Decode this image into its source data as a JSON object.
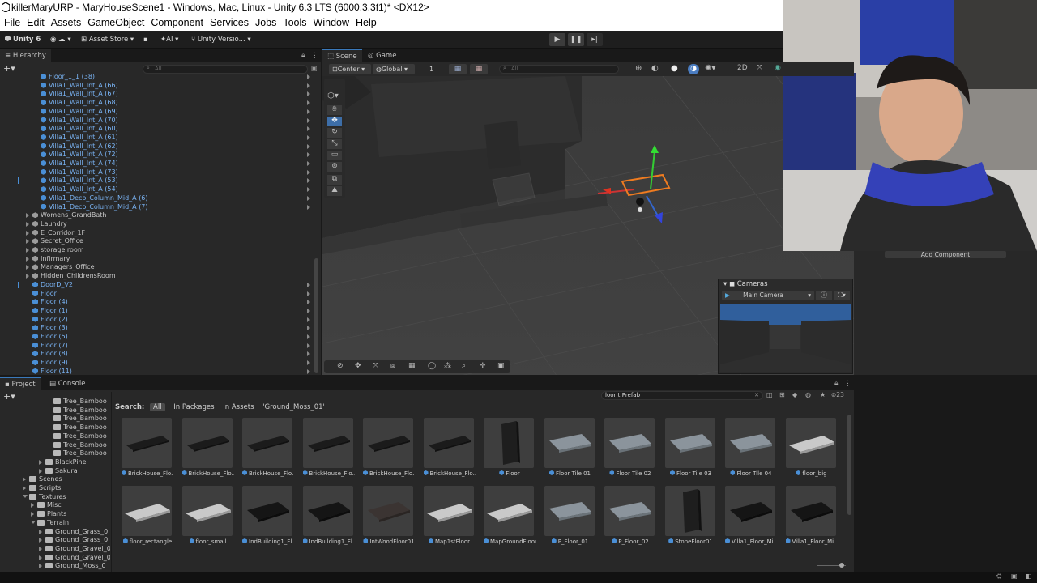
{
  "window": {
    "title": "killerMaryURP - MaryHouseScene1 - Windows, Mac, Linux - Unity 6.3 LTS (6000.3.3f1)* <DX12>"
  },
  "menu": [
    "File",
    "Edit",
    "Assets",
    "GameObject",
    "Component",
    "Services",
    "Jobs",
    "Tools",
    "Window",
    "Help"
  ],
  "toolbar": {
    "account": "Unity 6",
    "asset_store": "Asset Store",
    "ai": "AI",
    "version_control": "Unity Versio..."
  },
  "hierarchy": {
    "tab": "Hierarchy",
    "search_placeholder": "All",
    "rows": [
      {
        "label": "Floor_1_1 (38)",
        "prefab": true,
        "indent": 2
      },
      {
        "label": "Villa1_Wall_Int_A (66)",
        "prefab": true,
        "indent": 2
      },
      {
        "label": "Villa1_Wall_Int_A (67)",
        "prefab": true,
        "indent": 2
      },
      {
        "label": "Villa1_Wall_Int_A (68)",
        "prefab": true,
        "indent": 2
      },
      {
        "label": "Villa1_Wall_Int_A (69)",
        "prefab": true,
        "indent": 2
      },
      {
        "label": "Villa1_Wall_Int_A (70)",
        "prefab": true,
        "indent": 2
      },
      {
        "label": "Villa1_Wall_Int_A (60)",
        "prefab": true,
        "indent": 2
      },
      {
        "label": "Villa1_Wall_Int_A (61)",
        "prefab": true,
        "indent": 2
      },
      {
        "label": "Villa1_Wall_Int_A (62)",
        "prefab": true,
        "indent": 2
      },
      {
        "label": "Villa1_Wall_Int_A (72)",
        "prefab": true,
        "indent": 2
      },
      {
        "label": "Villa1_Wall_Int_A (74)",
        "prefab": true,
        "indent": 2
      },
      {
        "label": "Villa1_Wall_Int_A (73)",
        "prefab": true,
        "indent": 2
      },
      {
        "label": "Villa1_Wall_Int_A (53)",
        "prefab": true,
        "indent": 2
      },
      {
        "label": "Villa1_Wall_Int_A (54)",
        "prefab": true,
        "indent": 2
      },
      {
        "label": "Villa1_Deco_Column_Mid_A (6)",
        "prefab": true,
        "indent": 2
      },
      {
        "label": "Villa1_Deco_Column_Mid_A (7)",
        "prefab": true,
        "indent": 2
      },
      {
        "label": "Womens_GrandBath",
        "prefab": false,
        "indent": 1
      },
      {
        "label": "Laundry",
        "prefab": false,
        "indent": 1
      },
      {
        "label": "E_Corridor_1F",
        "prefab": false,
        "indent": 1
      },
      {
        "label": "Secret_Office",
        "prefab": false,
        "indent": 1
      },
      {
        "label": "storage room",
        "prefab": false,
        "indent": 1
      },
      {
        "label": "Infirmary",
        "prefab": false,
        "indent": 1
      },
      {
        "label": "Managers_Office",
        "prefab": false,
        "indent": 1
      },
      {
        "label": "Hidden_ChildrensRoom",
        "prefab": false,
        "indent": 1
      },
      {
        "label": "DoorD_V2",
        "prefab": true,
        "indent": 1
      },
      {
        "label": "Floor",
        "prefab": true,
        "indent": 1
      },
      {
        "label": "Floor (4)",
        "prefab": true,
        "indent": 1
      },
      {
        "label": "Floor (1)",
        "prefab": true,
        "indent": 1
      },
      {
        "label": "Floor (2)",
        "prefab": true,
        "indent": 1
      },
      {
        "label": "Floor (3)",
        "prefab": true,
        "indent": 1
      },
      {
        "label": "Floor (5)",
        "prefab": true,
        "indent": 1
      },
      {
        "label": "Floor (7)",
        "prefab": true,
        "indent": 1
      },
      {
        "label": "Floor (8)",
        "prefab": true,
        "indent": 1
      },
      {
        "label": "Floor (9)",
        "prefab": true,
        "indent": 1
      },
      {
        "label": "Floor (11)",
        "prefab": true,
        "indent": 1
      }
    ]
  },
  "scene": {
    "tabs": [
      "Scene",
      "Game"
    ],
    "pivot": "Center",
    "space": "Global",
    "grid_value": "1",
    "search_placeholder": "All"
  },
  "camera_overlay": {
    "title": "Cameras",
    "selected": "Main Camera"
  },
  "inspector": {
    "add_component": "Add Component"
  },
  "project": {
    "tabs": [
      "Project",
      "Console"
    ],
    "search_value": "loor t:Prefab",
    "count": "23",
    "search_label": "Search:",
    "filters": [
      "All",
      "In Packages",
      "In Assets",
      "'Ground_Moss_01'"
    ],
    "folders": [
      {
        "label": "Tree_Bamboo",
        "indent": 4
      },
      {
        "label": "Tree_Bamboo",
        "indent": 4
      },
      {
        "label": "Tree_Bamboo",
        "indent": 4
      },
      {
        "label": "Tree_Bamboo",
        "indent": 4
      },
      {
        "label": "Tree_Bamboo",
        "indent": 4
      },
      {
        "label": "Tree_Bamboo",
        "indent": 4
      },
      {
        "label": "Tree_Bamboo",
        "indent": 4
      },
      {
        "label": "BlackPine",
        "indent": 3
      },
      {
        "label": "Sakura",
        "indent": 3
      },
      {
        "label": "Scenes",
        "indent": 1
      },
      {
        "label": "Scripts",
        "indent": 1
      },
      {
        "label": "Textures",
        "indent": 1
      },
      {
        "label": "Misc",
        "indent": 2
      },
      {
        "label": "Plants",
        "indent": 2
      },
      {
        "label": "Terrain",
        "indent": 2
      },
      {
        "label": "Ground_Grass_0",
        "indent": 3
      },
      {
        "label": "Ground_Grass_0",
        "indent": 3
      },
      {
        "label": "Ground_Gravel_0",
        "indent": 3
      },
      {
        "label": "Ground_Gravel_0",
        "indent": 3
      },
      {
        "label": "Ground_Moss_0",
        "indent": 3
      }
    ],
    "assets_row1": [
      {
        "label": "BrickHouse_Flo...",
        "kind": "dark-slab"
      },
      {
        "label": "BrickHouse_Flo...",
        "kind": "dark-slab"
      },
      {
        "label": "BrickHouse_Flo...",
        "kind": "dark-slab"
      },
      {
        "label": "BrickHouse_Flo...",
        "kind": "dark-slab"
      },
      {
        "label": "BrickHouse_Flo...",
        "kind": "dark-slab"
      },
      {
        "label": "BrickHouse_Flo...",
        "kind": "dark-slab"
      },
      {
        "label": "Floor",
        "kind": "panel"
      },
      {
        "label": "Floor Tile 01",
        "kind": "tile"
      },
      {
        "label": "Floor Tile 02",
        "kind": "tile"
      },
      {
        "label": "Floor Tile 03",
        "kind": "tile"
      },
      {
        "label": "Floor Tile 04",
        "kind": "tile"
      },
      {
        "label": "floor_big",
        "kind": "light-slab"
      }
    ],
    "assets_row2": [
      {
        "label": "floor_rectangle",
        "kind": "light-slab"
      },
      {
        "label": "floor_small",
        "kind": "light-slab"
      },
      {
        "label": "IndBuilding1_Fl...",
        "kind": "black-slab"
      },
      {
        "label": "IndBuilding1_Fl...",
        "kind": "black-slab"
      },
      {
        "label": "IntWoodFloor01",
        "kind": "wood"
      },
      {
        "label": "Map1stFloor",
        "kind": "light-slab"
      },
      {
        "label": "MapGroundFloor",
        "kind": "light-slab"
      },
      {
        "label": "P_Floor_01",
        "kind": "tile"
      },
      {
        "label": "P_Floor_02",
        "kind": "tile"
      },
      {
        "label": "StoneFloor01",
        "kind": "panel"
      },
      {
        "label": "Villa1_Floor_Mi...",
        "kind": "black-slab"
      },
      {
        "label": "Villa1_Floor_Mi...",
        "kind": "black-slab"
      }
    ]
  }
}
